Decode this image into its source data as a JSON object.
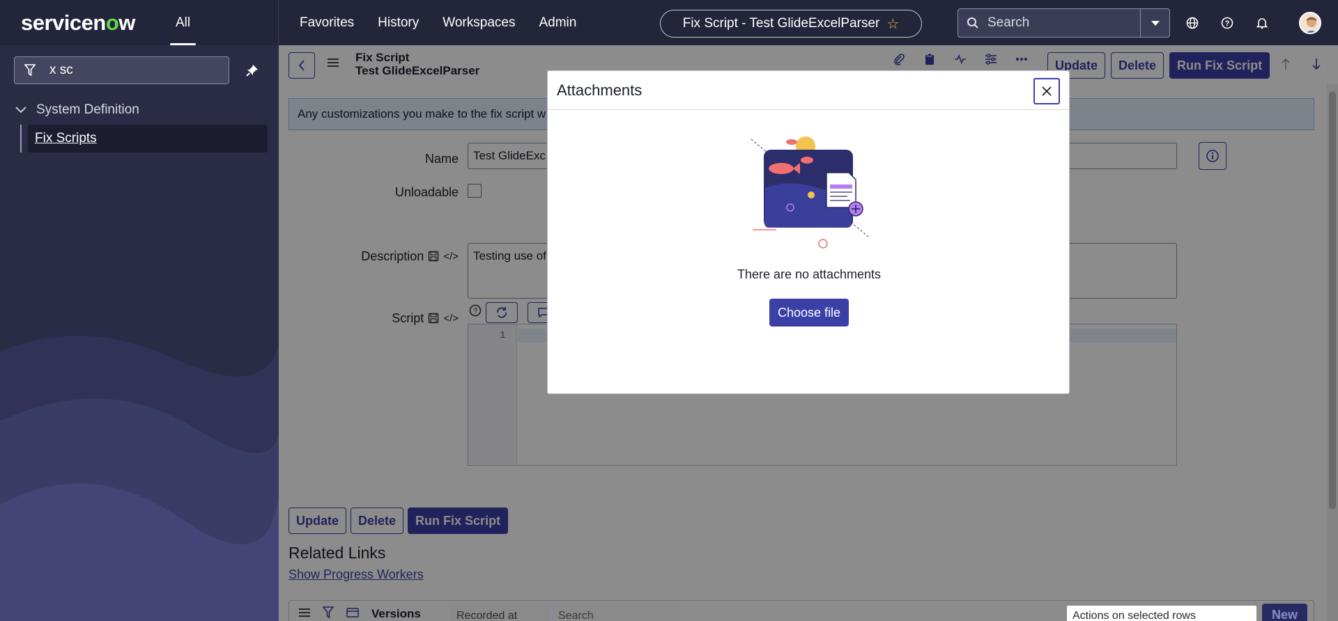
{
  "header": {
    "logo_pre": "servicen",
    "logo_o": "o",
    "logo_post": "w",
    "all_tab": "All",
    "nav": [
      "Favorites",
      "History",
      "Workspaces",
      "Admin"
    ],
    "record_title": "Fix Script - Test GlideExcelParser",
    "search_placeholder": "Search"
  },
  "sidebar": {
    "filter_value": "x sc",
    "section": "System Definition",
    "item": "Fix Scripts"
  },
  "form": {
    "table_label": "Fix Script",
    "record_name": "Test GlideExcelParser",
    "buttons": {
      "update": "Update",
      "delete": "Delete",
      "run": "Run Fix Script"
    },
    "banner": "Any customizations you make to the fix script w",
    "fields": {
      "name_label": "Name",
      "name_value": "Test GlideExc",
      "unloadable_label": "Unloadable",
      "description_label": "Description",
      "description_value": "Testing use of",
      "script_label": "Script",
      "line_number": "1"
    }
  },
  "related": {
    "title": "Related Links",
    "link": "Show Progress Workers"
  },
  "list": {
    "title": "Versions",
    "select_value": "Recorded at",
    "search_placeholder": "Search",
    "actions_value": "Actions on selected rows",
    "new_button": "New"
  },
  "modal": {
    "title": "Attachments",
    "empty_text": "There are no attachments",
    "choose_button": "Choose file"
  },
  "colors": {
    "header_bg": "#23253a",
    "sidebar_bg": "#2a2b45",
    "accent": "#3b3fa6",
    "logo_green": "#62d84e",
    "star": "#f0c23c"
  }
}
